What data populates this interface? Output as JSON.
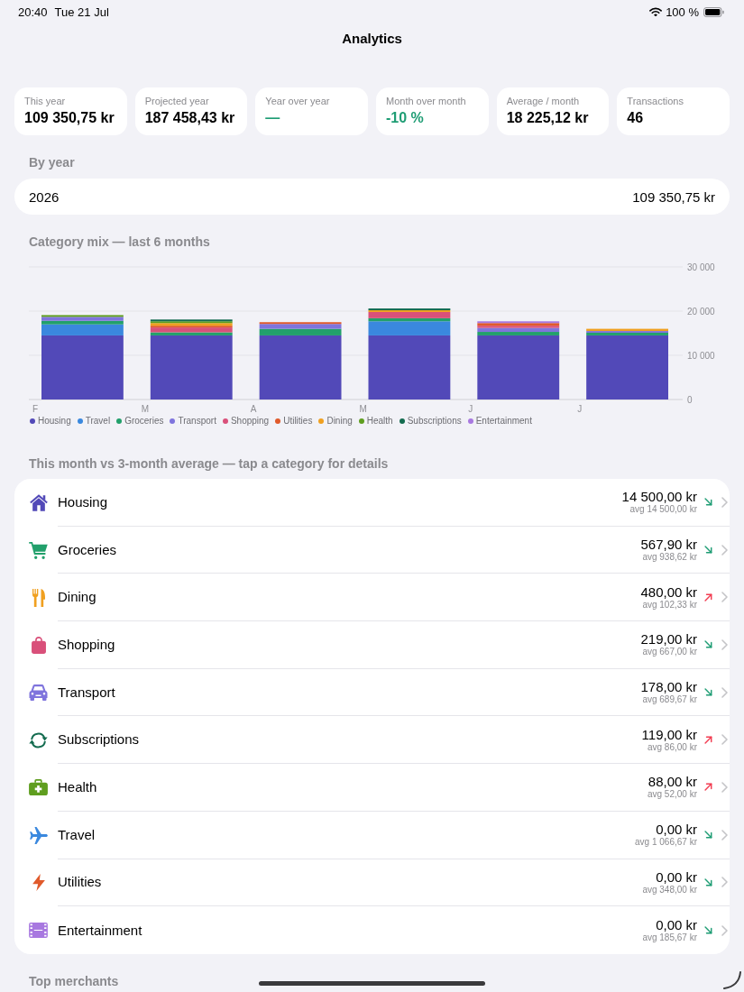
{
  "status_bar": {
    "time": "20:40",
    "date": "Tue 21 Jul",
    "battery": "100 %"
  },
  "navigation": {
    "title": "Analytics"
  },
  "stats": [
    {
      "label": "This year",
      "value": "109 350,75 kr",
      "positive": false
    },
    {
      "label": "Projected year",
      "value": "187 458,43 kr",
      "positive": false
    },
    {
      "label": "Year over year",
      "value": "—",
      "positive": true
    },
    {
      "label": "Month over month",
      "value": "-10 %",
      "positive": true
    },
    {
      "label": "Average / month",
      "value": "18 225,12 kr",
      "positive": false
    },
    {
      "label": "Transactions",
      "value": "46",
      "positive": false
    }
  ],
  "by_year": {
    "title": "By year",
    "rows": [
      {
        "year": "2026",
        "amount": "109 350,75 kr"
      }
    ]
  },
  "category_mix": {
    "chart_data": {
      "type": "bar",
      "title": "Category mix — last 6 months",
      "categories": [
        "F",
        "M",
        "A",
        "M",
        "J",
        "J"
      ],
      "stacked": true,
      "legend": "bottom",
      "ylim": [
        0,
        30000
      ],
      "yticks": [
        {
          "value": 0,
          "label": "0"
        },
        {
          "value": 10000,
          "label": "10 000"
        },
        {
          "value": 20000,
          "label": "20 000"
        },
        {
          "value": 30000,
          "label": "30 000"
        }
      ],
      "series": [
        {
          "name": "Housing",
          "color": "#5249b8",
          "values": [
            14500,
            14500,
            14500,
            14500,
            14500,
            14500
          ]
        },
        {
          "name": "Travel",
          "color": "#3a88de",
          "values": [
            2500,
            0,
            0,
            3200,
            0,
            0
          ]
        },
        {
          "name": "Groceries",
          "color": "#22a06b",
          "values": [
            800,
            700,
            1500,
            700,
            800,
            600
          ]
        },
        {
          "name": "Transport",
          "color": "#7f74dd",
          "values": [
            900,
            0,
            1100,
            0,
            900,
            400
          ]
        },
        {
          "name": "Shopping",
          "color": "#d9507a",
          "values": [
            0,
            1100,
            0,
            1400,
            500,
            0
          ]
        },
        {
          "name": "Utilities",
          "color": "#e05a2b",
          "values": [
            0,
            400,
            400,
            0,
            600,
            0
          ]
        },
        {
          "name": "Dining",
          "color": "#f0a020",
          "values": [
            0,
            600,
            0,
            400,
            0,
            500
          ]
        },
        {
          "name": "Health",
          "color": "#5f9e1f",
          "values": [
            400,
            400,
            0,
            0,
            0,
            0
          ]
        },
        {
          "name": "Subscriptions",
          "color": "#136b4f",
          "values": [
            0,
            400,
            0,
            400,
            0,
            0
          ]
        },
        {
          "name": "Entertainment",
          "color": "#a878e0",
          "values": [
            0,
            0,
            0,
            0,
            400,
            0
          ]
        }
      ]
    }
  },
  "comparison": {
    "title": "This month vs 3-month average — tap a category for details",
    "categories": [
      {
        "name": "Housing",
        "kind": "house",
        "color": "#5249b8",
        "amount": "14 500,00 kr",
        "average": "avg 14 500,00 kr",
        "increase": false
      },
      {
        "name": "Groceries",
        "kind": "cart",
        "color": "#22a06b",
        "amount": "567,90 kr",
        "average": "avg 938,62 kr",
        "increase": false
      },
      {
        "name": "Dining",
        "kind": "cutlery",
        "color": "#f0a020",
        "amount": "480,00 kr",
        "average": "avg 102,33 kr",
        "increase": true
      },
      {
        "name": "Shopping",
        "kind": "bag",
        "color": "#d9507a",
        "amount": "219,00 kr",
        "average": "avg 667,00 kr",
        "increase": false
      },
      {
        "name": "Transport",
        "kind": "car",
        "color": "#7f74dd",
        "amount": "178,00 kr",
        "average": "avg 689,67 kr",
        "increase": false
      },
      {
        "name": "Subscriptions",
        "kind": "cycle",
        "color": "#136b4f",
        "amount": "119,00 kr",
        "average": "avg 86,00 kr",
        "increase": true
      },
      {
        "name": "Health",
        "kind": "medkit",
        "color": "#5f9e1f",
        "amount": "88,00 kr",
        "average": "avg 52,00 kr",
        "increase": true
      },
      {
        "name": "Travel",
        "kind": "plane",
        "color": "#3a88de",
        "amount": "0,00 kr",
        "average": "avg 1 066,67 kr",
        "increase": false
      },
      {
        "name": "Utilities",
        "kind": "bolt",
        "color": "#e05a2b",
        "amount": "0,00 kr",
        "average": "avg 348,00 kr",
        "increase": false
      },
      {
        "name": "Entertainment",
        "kind": "film",
        "color": "#a878e0",
        "amount": "0,00 kr",
        "average": "avg 185,67 kr",
        "increase": false
      }
    ]
  },
  "next_section": {
    "title": "Top merchants"
  }
}
